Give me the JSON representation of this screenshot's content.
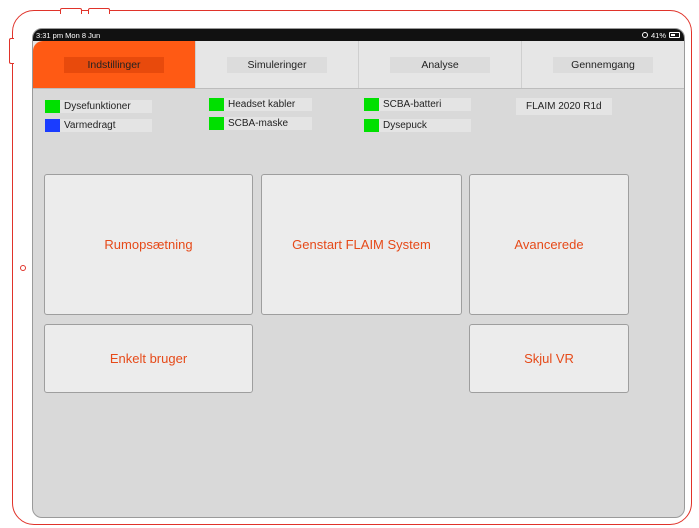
{
  "status_bar": {
    "time_date": "3:31 pm  Mon 8 Jun",
    "battery": "41%"
  },
  "tabs": [
    {
      "label": "Indstillinger",
      "active": true
    },
    {
      "label": "Simuleringer",
      "active": false
    },
    {
      "label": "Analyse",
      "active": false
    },
    {
      "label": "Gennemgang",
      "active": false
    }
  ],
  "indicators": [
    {
      "label": "Dysefunktioner",
      "color": "#00e000"
    },
    {
      "label": "Varmedragt",
      "color": "#1a3cff"
    },
    {
      "label": "Headset kabler",
      "color": "#00e000"
    },
    {
      "label": "SCBA-maske",
      "color": "#00e000"
    },
    {
      "label": "SCBA-batteri",
      "color": "#00e000"
    },
    {
      "label": "Dysepuck",
      "color": "#00e000"
    }
  ],
  "version": "FLAIM 2020 R1d",
  "buttons": {
    "room_setup": "Rumopsætning",
    "restart": "Genstart FLAIM System",
    "advanced": "Avancerede",
    "single_user": "Enkelt bruger",
    "hide_vr": "Skjul VR"
  },
  "colors": {
    "accent": "#ff5a14",
    "button_text": "#e64a19",
    "frame": "#e0332a"
  }
}
